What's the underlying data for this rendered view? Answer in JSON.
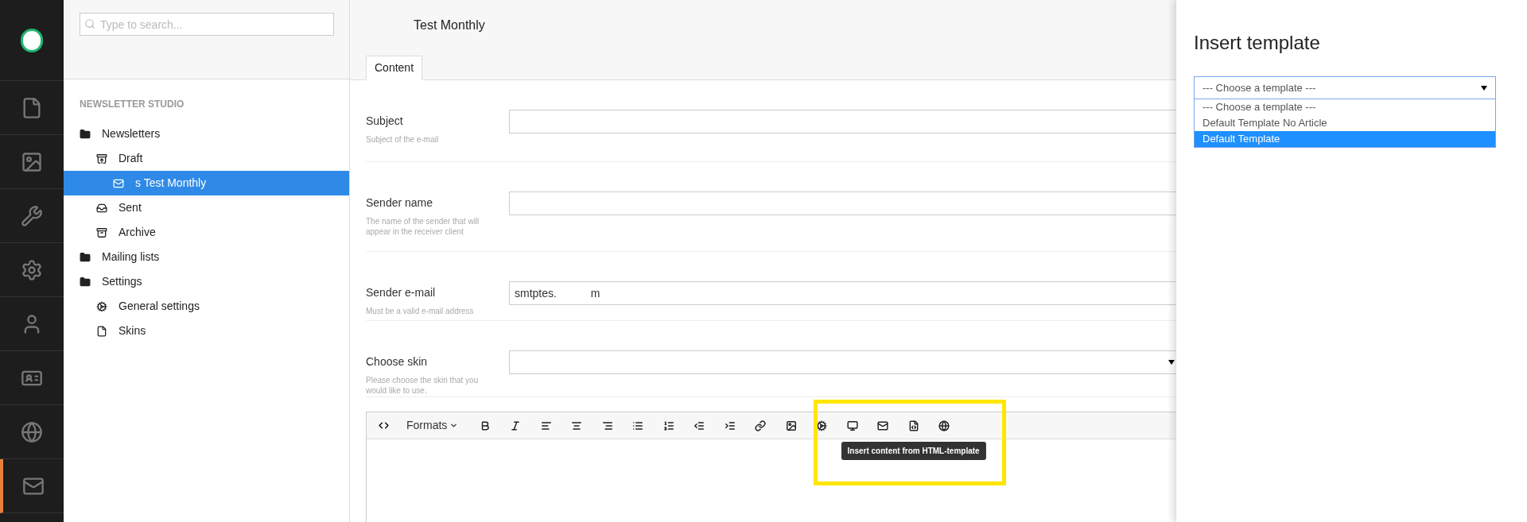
{
  "nav": [
    {
      "selected": false
    },
    {
      "selected": false
    },
    {
      "selected": false
    },
    {
      "selected": false
    },
    {
      "selected": false
    },
    {
      "selected": false
    },
    {
      "selected": false
    },
    {
      "selected": true
    }
  ],
  "tree": {
    "search": {
      "placeholder": "Type to search..."
    },
    "section_title": "NEWSLETTER STUDIO",
    "items": [
      {
        "label": "Newsletters",
        "kind": "folder",
        "selected": false,
        "children": [
          {
            "label": "Draft",
            "kind": "draft",
            "selected": false,
            "children": [
              {
                "label": "s Test Monthly",
                "kind": "mail",
                "selected": true
              }
            ]
          },
          {
            "label": "Sent",
            "kind": "inbox",
            "selected": false
          },
          {
            "label": "Archive",
            "kind": "archive",
            "selected": false
          }
        ]
      },
      {
        "label": "Mailing lists",
        "kind": "folder",
        "selected": false
      },
      {
        "label": "Settings",
        "kind": "folder",
        "selected": false,
        "children": [
          {
            "label": "General settings",
            "kind": "gear",
            "selected": false
          },
          {
            "label": "Skins",
            "kind": "document",
            "selected": false
          }
        ]
      }
    ]
  },
  "editor": {
    "title": "Test Monthly",
    "tabs": [
      {
        "label": "Content",
        "selected": true
      }
    ],
    "fields": [
      {
        "label": "Subject",
        "hint": "Subject of the e-mail",
        "kind": "text"
      },
      {
        "label": "Sender name",
        "hint": "The name of the sender that will appear in the receiver client",
        "kind": "text"
      },
      {
        "label": "Sender e-mail",
        "hint": "Must be a valid e-mail address",
        "kind": "text",
        "value": "smtptes.           m"
      },
      {
        "label": "Choose skin",
        "hint": "Please choose the skin that you would like to use.",
        "kind": "select"
      }
    ],
    "toolbar": {
      "formats_label": "Formats",
      "tooltip": "Insert content from HTML-template"
    }
  },
  "panel": {
    "title": "Insert template",
    "select": {
      "value": "--- Choose a template ---",
      "options": [
        {
          "label": "--- Choose a template ---",
          "highlighted": false
        },
        {
          "label": "Default Template No Article",
          "highlighted": false
        },
        {
          "label": "Default Template",
          "highlighted": true
        }
      ]
    }
  }
}
